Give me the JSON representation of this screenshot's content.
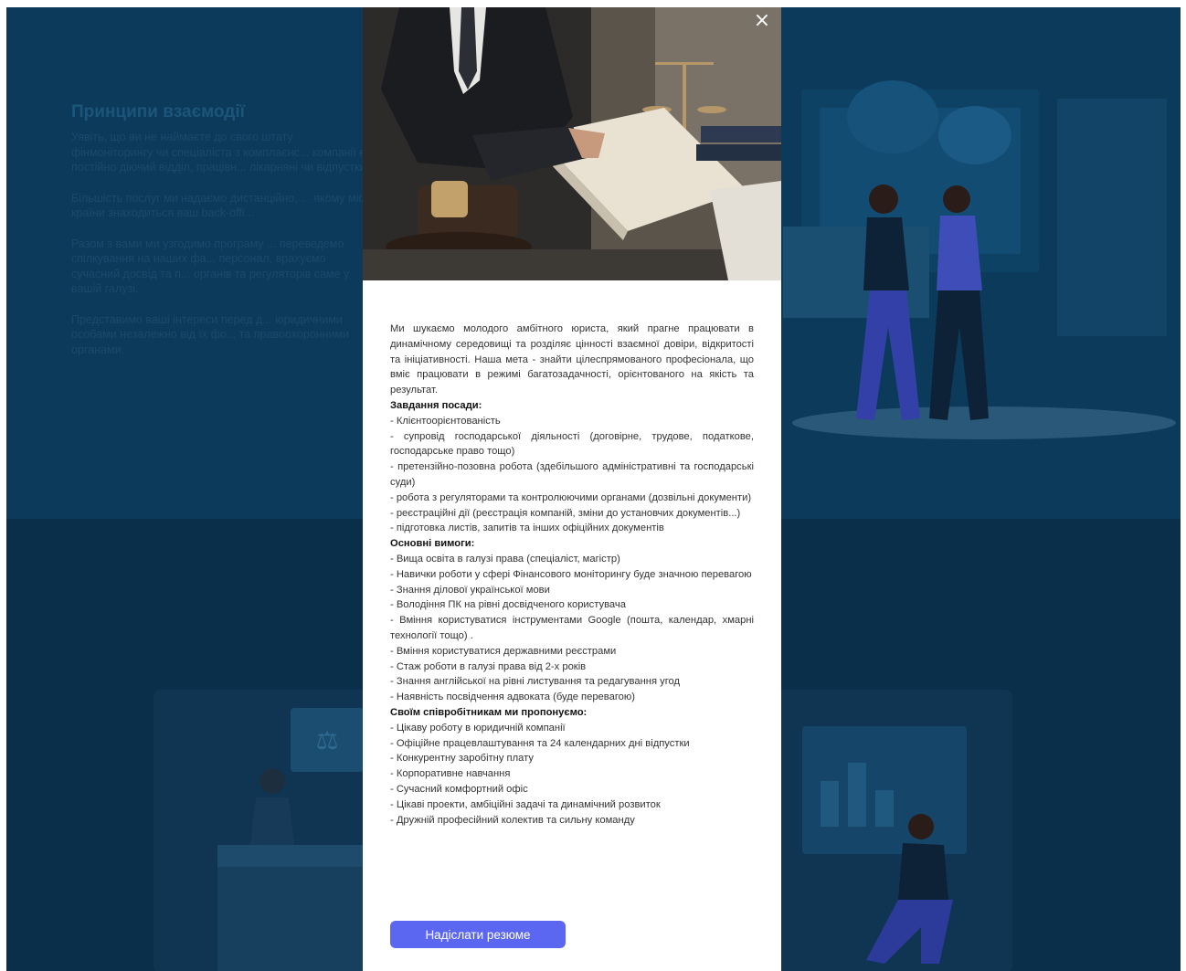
{
  "background": {
    "section_title": "Принципи взаємодії",
    "paragraphs": [
      "Уявіть, що ви не наймаєте до свого штату фінмоніторингу чи спеціаліста з комплаєнс... компанії є постійно діючий відділ, працівн... лікарняні чи відпустки.",
      "Більшість послуг ми надаємо дистанційно, ... якому місті країни знаходиться ваш back-offi...",
      "Разом з вами ми узгодимо програму ... переведемо спілкування на наших фа... персонал, врахуємо сучасний досвід та п... органів та регуляторів саме у вашій галузі.",
      "Представимо ваші інтереси перед д... юридичними особами незалежно від їх фо... та правоохоронними органами."
    ]
  },
  "modal": {
    "close_label": "×",
    "intro": "Ми шукаємо молодого амбітного юриста, який прагне працювати в динамічному середовищі та розділяє цінності взаємної довіри, відкритості та ініціативності. Наша мета - знайти цілеспрямованого професіонала, що вміє працювати в режимі багатозадачності, орієнтованого на якість та результат.",
    "sections": [
      {
        "title": "Завдання посади:",
        "items": [
          "- Клієнтоорієнтованість",
          "- супровід господарської діяльності (договірне, трудове, податкове, господарське право тощо)",
          "- претензійно-позовна робота (здебільшого адміністративні та господарські суди)",
          "- робота з регуляторами та контролюючими органами (дозвільні документи)",
          "- реєстраційні дії (реєстрація компаній, зміни до установчих документів...)",
          "- підготовка листів, запитів та інших офіційних документів"
        ]
      },
      {
        "title": "Основні вимоги:",
        "items": [
          "- Вища освіта в галузі права (спеціаліст, магістр)",
          "- Навички роботи у сфері Фінансового моніторингу буде значною перевагою",
          "- Знання ділової української мови",
          "- Володіння ПК на рівні досвідченого користувача",
          "- Вміння користуватися інструментами Google (пошта, календар, хмарні технології тощо) .",
          "- Вміння користуватися державними реєстрами",
          "- Стаж роботи в галузі права від 2-х років",
          "- Знання англійської на рівні листування та редагування угод",
          "- Наявність посвідчення адвоката (буде перевагою)"
        ]
      },
      {
        "title": "Своїм співробітникам ми пропонуємо:",
        "items": [
          "- Цікаву роботу в юридичній компанії",
          "- Офіційне працевлаштування та 24 календарних дні відпустки",
          "- Конкурентну заробітну плату",
          "- Корпоративне навчання",
          "- Сучасний комфортний офіс",
          "- Цікаві проекти, амбіційні задачі та динамічний розвиток",
          "- Дружній професійний колектив та сильну команду"
        ]
      }
    ],
    "apply_label": "Надіслати резюме"
  },
  "colors": {
    "page_background": "#0c3a5a",
    "button": "#5b67f1",
    "text": "#333333"
  },
  "icons": [
    "close-icon"
  ]
}
